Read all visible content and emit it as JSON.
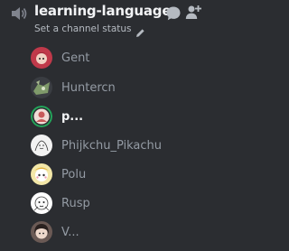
{
  "channel": {
    "name": "learning-language",
    "status_placeholder": "Set a channel status",
    "icon": "speaker-muted-icon"
  },
  "header_actions": [
    {
      "icon": "chat-bubble-icon"
    },
    {
      "icon": "add-user-icon"
    }
  ],
  "members": [
    {
      "name": "Gent",
      "avatar": "red-anime-avatar"
    },
    {
      "name": "Huntercn",
      "avatar": "green-robot-avatar"
    },
    {
      "name": "p...",
      "avatar": "green-ring-avatar",
      "speaking": true
    },
    {
      "name": "Phijkchu_Pikachu",
      "avatar": "sketch-avatar"
    },
    {
      "name": "Polu",
      "avatar": "yellow-cartoon-avatar"
    },
    {
      "name": "Rusp",
      "avatar": "white-cartoon-avatar"
    },
    {
      "name": "V...",
      "avatar": "dark-hair-avatar"
    }
  ],
  "colors": {
    "background": "#2b2d31",
    "channel_name": "#f2f3f5",
    "member_text": "#949ba4",
    "status_text": "#b5bac1",
    "speaking_ring": "#23a55a"
  }
}
